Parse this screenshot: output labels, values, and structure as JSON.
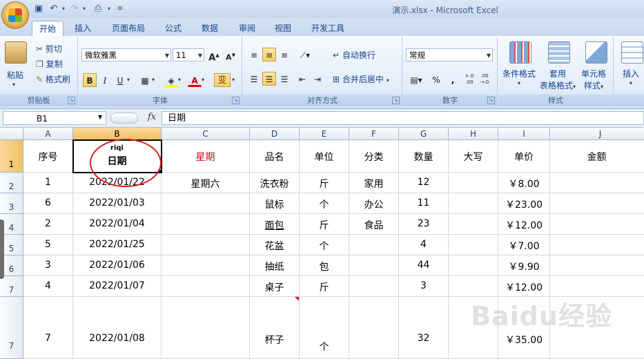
{
  "window": {
    "title": "演示.xlsx - Microsoft Excel"
  },
  "qat": {
    "icons": [
      "save-icon",
      "undo-icon",
      "redo-icon",
      "print-preview-icon",
      "customize-qat-icon"
    ]
  },
  "tabs": [
    "开始",
    "插入",
    "页面布局",
    "公式",
    "数据",
    "审阅",
    "视图",
    "开发工具"
  ],
  "active_tab": "开始",
  "ribbon": {
    "clipboard": {
      "label": "剪贴板",
      "paste": "粘贴",
      "cut": "剪切",
      "copy": "复制",
      "format_painter": "格式刷"
    },
    "font": {
      "label": "字体",
      "name": "微软雅黑",
      "size": "11",
      "grow": "A",
      "shrink": "A",
      "bold": "B",
      "italic": "I",
      "underline": "U",
      "phonetic": "变"
    },
    "alignment": {
      "label": "对齐方式",
      "wrap_text": "自动换行",
      "merge_center": "合并后居中"
    },
    "number": {
      "label": "数字",
      "format": "常规",
      "percent": "%",
      "comma": ",",
      "inc_decimal": "+.0 .00",
      "dec_decimal": ".00 →.0"
    },
    "styles": {
      "label": "样式",
      "conditional": "条件格式",
      "table_format_1": "套用",
      "table_format_2": "表格格式",
      "cell_styles_1": "单元格",
      "cell_styles_2": "样式"
    },
    "cells": {
      "insert": "插入"
    }
  },
  "formula_bar": {
    "name_box": "B1",
    "fx": "fx",
    "content": "日期"
  },
  "columns": [
    "A",
    "B",
    "C",
    "D",
    "E",
    "F",
    "G",
    "H",
    "I",
    "J"
  ],
  "selected_column": "B",
  "row_numbers": [
    "1",
    "2",
    "3",
    "4",
    "5",
    "6",
    "7",
    "",
    "7"
  ],
  "header_row": {
    "a": "序号",
    "b_phonetic": "riqi",
    "b": "日期",
    "c": "星期",
    "d": "品名",
    "e": "单位",
    "f": "分类",
    "g": "数量",
    "h": "大写",
    "i": "单价",
    "j": "金额"
  },
  "rows": [
    {
      "a": "1",
      "b": "2022/01/22",
      "c": "星期六",
      "d": "洗衣粉",
      "e": "斤",
      "f": "家用",
      "g": "12",
      "h": "",
      "i": "￥8.00",
      "j": ""
    },
    {
      "a": "6",
      "b": "2022/01/03",
      "c": "",
      "d": "鼠标",
      "e": "个",
      "f": "办公",
      "g": "11",
      "h": "",
      "i": "￥23.00",
      "j": ""
    },
    {
      "a": "2",
      "b": "2022/01/04",
      "c": "",
      "d": "面包",
      "e": "斤",
      "f": "食品",
      "g": "23",
      "h": "",
      "i": "￥12.00",
      "j": ""
    },
    {
      "a": "5",
      "b": "2022/01/25",
      "c": "",
      "d": "花盆",
      "e": "个",
      "f": "",
      "g": "4",
      "h": "",
      "i": "￥7.00",
      "j": ""
    },
    {
      "a": "3",
      "b": "2022/01/06",
      "c": "",
      "d": "抽纸",
      "e": "包",
      "f": "",
      "g": "44",
      "h": "",
      "i": "￥9.90",
      "j": ""
    },
    {
      "a": "4",
      "b": "2022/01/07",
      "c": "",
      "d": "桌子",
      "e": "斤",
      "f": "",
      "g": "3",
      "h": "",
      "i": "￥12.00",
      "j": ""
    },
    {
      "a": "7",
      "b": "2022/01/08",
      "c": "",
      "d": "杯子",
      "e": "个",
      "f": "",
      "g": "32",
      "h": "",
      "i": "￥35.00",
      "j": ""
    }
  ],
  "watermark": "Baidu经验",
  "colors": {
    "accent_red": "#c0101a",
    "annotation_circle": "#d62020",
    "selected_header": "#f1c15f"
  }
}
